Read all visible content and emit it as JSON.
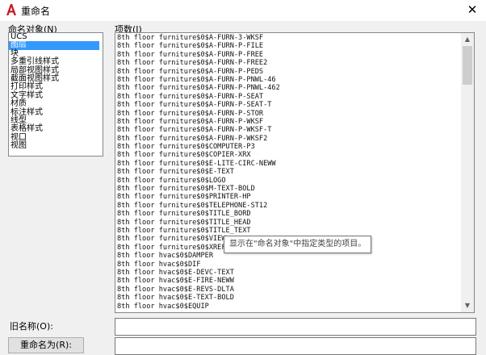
{
  "window": {
    "title": "重命名",
    "close_glyph": "✕"
  },
  "types": {
    "label": "命名对象(N)",
    "items": [
      "UCS",
      "图层",
      "块",
      "多重引线样式",
      "局部视图样式",
      "截面视图样式",
      "打印样式",
      "文字样式",
      "材质",
      "标注样式",
      "线型",
      "表格样式",
      "视口",
      "视图"
    ],
    "selected_index": 1
  },
  "items": {
    "label": "项数(I)",
    "rows": [
      "8th floor furniture$0$A-FURN-3-WKSF",
      "8th floor furniture$0$A-FURN-P-FILE",
      "8th floor furniture$0$A-FURN-P-FREE",
      "8th floor furniture$0$A-FURN-P-FREE2",
      "8th floor furniture$0$A-FURN-P-PEDS",
      "8th floor furniture$0$A-FURN-P-PNWL-46",
      "8th floor furniture$0$A-FURN-P-PNWL-462",
      "8th floor furniture$0$A-FURN-P-SEAT",
      "8th floor furniture$0$A-FURN-P-SEAT-T",
      "8th floor furniture$0$A-FURN-P-STOR",
      "8th floor furniture$0$A-FURN-P-WKSF",
      "8th floor furniture$0$A-FURN-P-WKSF-T",
      "8th floor furniture$0$A-FURN-P-WKSF2",
      "8th floor furniture$0$COMPUTER-P3",
      "8th floor furniture$0$COPIER-XRX",
      "8th floor furniture$0$E-LITE-CIRC-NEWW",
      "8th floor furniture$0$E-TEXT",
      "8th floor furniture$0$LOGO",
      "8th floor furniture$0$M-TEXT-BOLD",
      "8th floor furniture$0$PRINTER-HP",
      "8th floor furniture$0$TELEPHONE-ST12",
      "8th floor furniture$0$TITLE_BORD",
      "8th floor furniture$0$TITLE_HEAD",
      "8th floor furniture$0$TITLE_TEXT",
      "8th floor furniture$0$VIEW",
      "8th floor furniture$0$XREF",
      "8th floor hvac$0$DAMPER",
      "8th floor hvac$0$DIF",
      "8th floor hvac$0$E-DEVC-TEXT",
      "8th floor hvac$0$E-FIRE-NEWW",
      "8th floor hvac$0$E-REVS-DLTA",
      "8th floor hvac$0$E-TEXT-BOLD",
      "8th floor hvac$0$EQUIP"
    ],
    "tooltip": "显示在\"命名对象\"中指定类型的项目。"
  },
  "old_name": {
    "label": "旧名称(O):",
    "value": ""
  },
  "rename": {
    "button_label": "重命名为(R):",
    "value": ""
  },
  "colors": {
    "accent": "#3399ff",
    "app_icon": "#c8161d"
  }
}
